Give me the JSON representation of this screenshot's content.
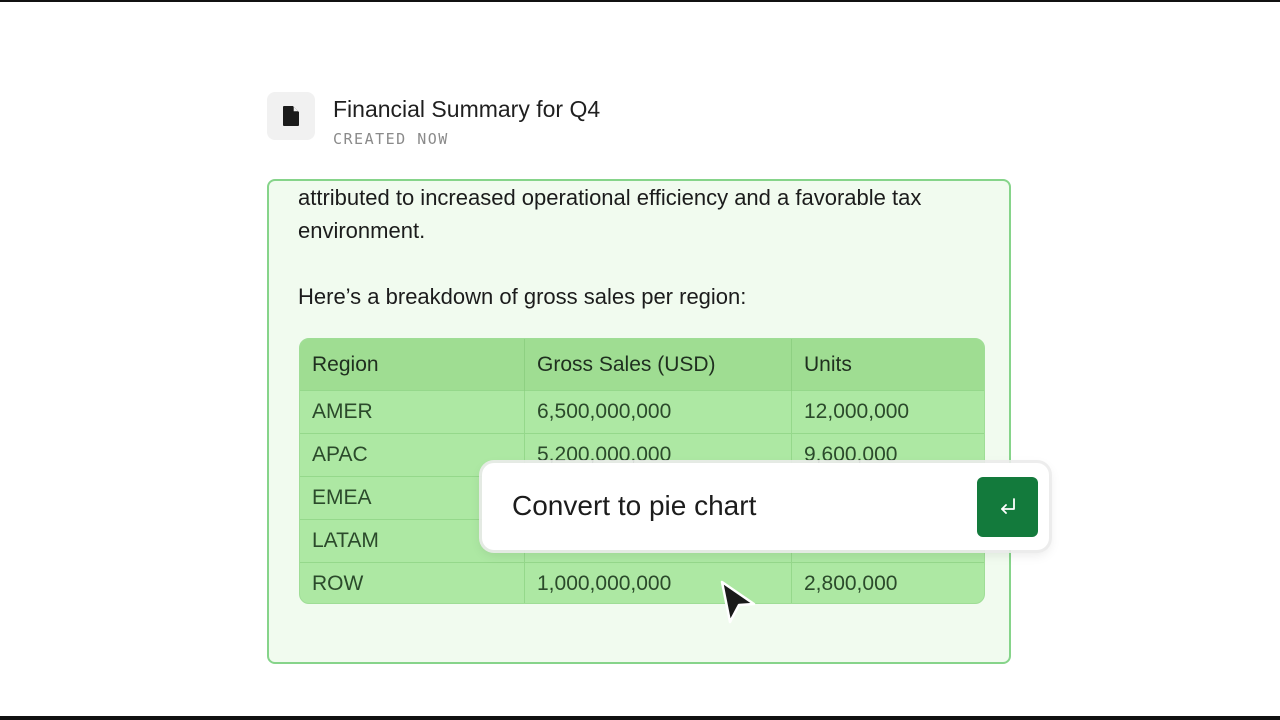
{
  "document": {
    "title": "Financial Summary for Q4",
    "meta": "CREATED NOW",
    "icon": "document-icon"
  },
  "content": {
    "paragraph_1": "attributed to increased operational efficiency and a favorable tax environment.",
    "paragraph_2": "Here’s a breakdown of gross sales per region:"
  },
  "table": {
    "headers": [
      "Region",
      "Gross Sales (USD)",
      "Units"
    ],
    "rows": [
      [
        "AMER",
        "6,500,000,000",
        "12,000,000"
      ],
      [
        "APAC",
        "5,200,000,000",
        "9,600,000"
      ],
      [
        "EMEA",
        "",
        ""
      ],
      [
        "LATAM",
        "",
        ""
      ],
      [
        "ROW",
        "1,000,000,000",
        "2,800,000"
      ]
    ]
  },
  "prompt": {
    "text": "Convert to pie chart",
    "submit_icon": "enter-return-icon",
    "submit_color": "#137a3c"
  },
  "colors": {
    "card_border": "#86d48a",
    "card_background": "#f1fbef",
    "table_fill": "#ade8a3"
  }
}
